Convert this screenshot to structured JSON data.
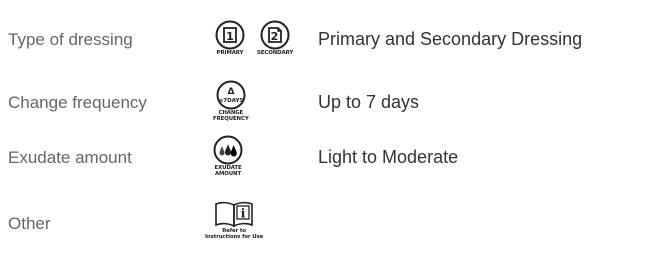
{
  "rows": [
    {
      "label": "Type of dressing",
      "value": "Primary and Secondary Dressing",
      "icons": [
        {
          "name": "primary-icon",
          "glyph": "1",
          "caption": "PRIMARY"
        },
        {
          "name": "secondary-icon",
          "glyph": "2",
          "caption": "SECONDARY"
        }
      ]
    },
    {
      "label": "Change frequency",
      "value": "Up to 7 days",
      "icons": [
        {
          "name": "change-frequency-icon",
          "glyph_top": "Δ",
          "glyph_bottom": "≤7DAYS",
          "caption_line1": "CHANGE",
          "caption_line2": "FREQUENCY"
        }
      ]
    },
    {
      "label": "Exudate amount",
      "value": "Light to Moderate",
      "icons": [
        {
          "name": "exudate-amount-icon",
          "caption_line1": "EXUDATE",
          "caption_line2": "AMOUNT"
        }
      ]
    },
    {
      "label": "Other",
      "value": "",
      "icons": [
        {
          "name": "instructions-for-use-icon",
          "glyph": "i",
          "caption_line1": "Refer to",
          "caption_line2": "Instructions for Use"
        }
      ]
    }
  ],
  "colors": {
    "label": "#666666",
    "value": "#333333",
    "icon_stroke": "#222222"
  }
}
